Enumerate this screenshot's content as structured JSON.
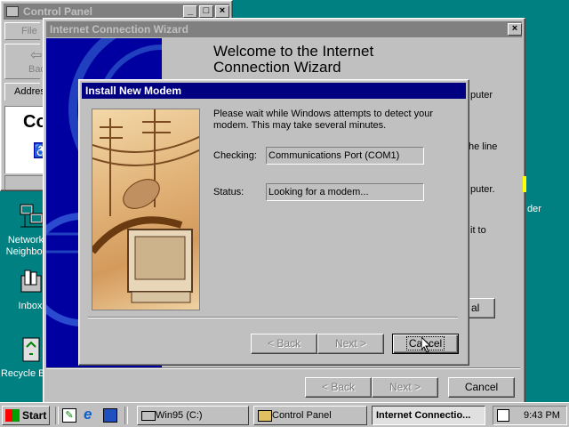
{
  "control_panel": {
    "title": "Control Panel",
    "menu_file": "File",
    "back_label": "Back",
    "address_label": "Address",
    "content_text": "Co"
  },
  "desktop_icons": [
    {
      "label": "Network Neighborhood"
    },
    {
      "label": "Inbox"
    },
    {
      "label": "Recycle Bin"
    }
  ],
  "right_clipped_text": {
    "t1": "puter",
    "t2": "he line",
    "t3": "puter.",
    "t4": "it to",
    "t5": "der"
  },
  "wizard": {
    "title": "Internet Connection Wizard",
    "heading": "Welcome to the Internet Connection Wizard",
    "back_label": "< Back",
    "next_label": "Next >",
    "cancel_label": "Cancel",
    "partial_btn": "al"
  },
  "modem": {
    "title": "Install New Modem",
    "message": "Please wait while Windows attempts to detect your modem.  This may take several minutes.",
    "checking_label": "Checking:",
    "checking_value": "Communications Port (COM1)",
    "status_label": "Status:",
    "status_value": "Looking for a modem...",
    "back_label": "< Back",
    "next_label": "Next >",
    "cancel_label": "Cancel"
  },
  "taskbar": {
    "start_label": "Start",
    "items": [
      {
        "label": "Win95 (C:)"
      },
      {
        "label": "Control Panel"
      },
      {
        "label": "Internet Connectio..."
      }
    ],
    "clock": "9:43 PM"
  }
}
